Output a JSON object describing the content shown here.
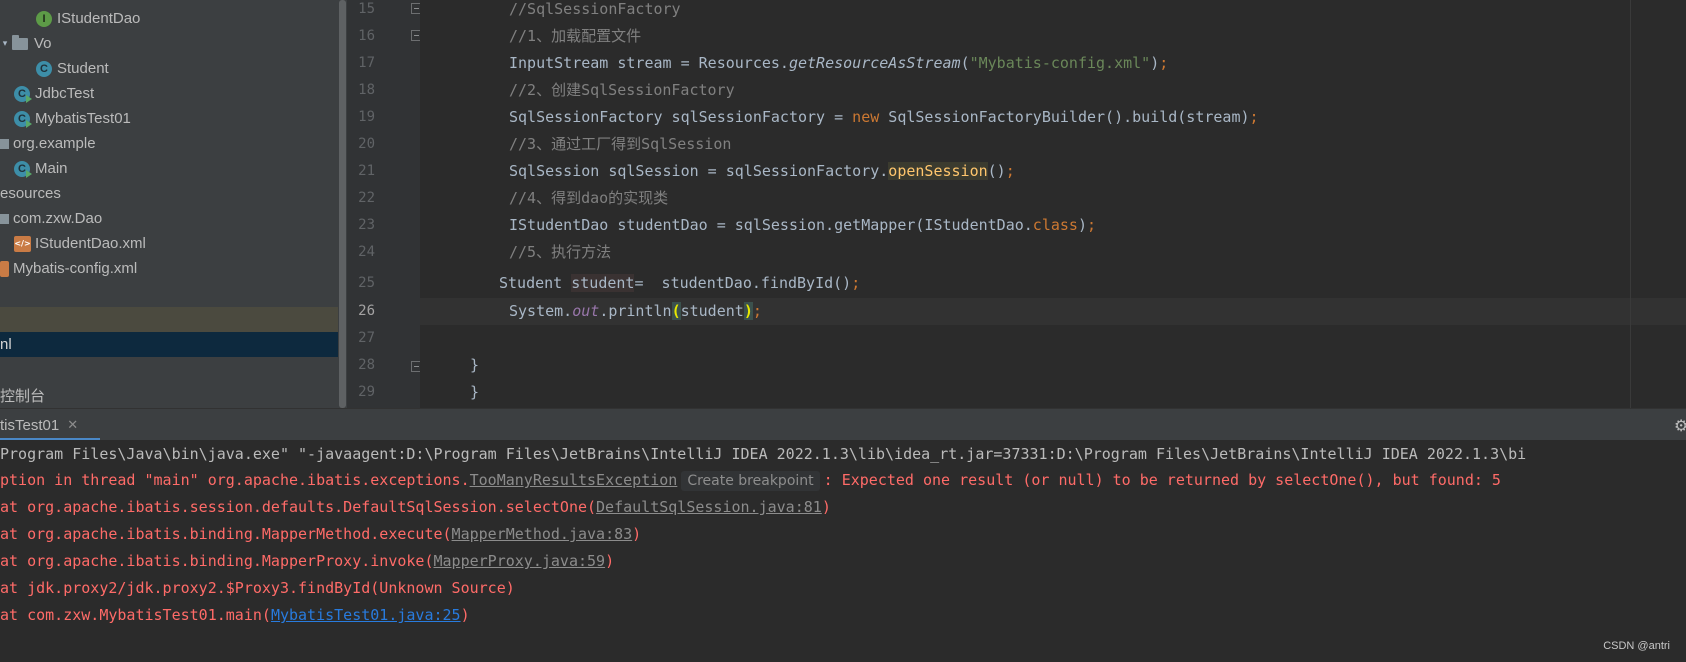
{
  "project_tree": {
    "items": [
      {
        "label": "IStudentDao",
        "icon": "interface-icon"
      },
      {
        "label": "Vo",
        "icon": "folder-icon"
      },
      {
        "label": "Student",
        "icon": "class-icon"
      },
      {
        "label": "JdbcTest",
        "icon": "class-icon"
      },
      {
        "label": "MybatisTest01",
        "icon": "class-icon"
      },
      {
        "label": "org.example",
        "icon": "package-icon"
      },
      {
        "label": "Main",
        "icon": "class-icon"
      },
      {
        "label": "esources",
        "icon": "none"
      },
      {
        "label": "com.zxw.Dao",
        "icon": "package-icon"
      },
      {
        "label": "IStudentDao.xml",
        "icon": "xml-icon"
      },
      {
        "label": "Mybatis-config.xml",
        "icon": "xml-icon"
      },
      {
        "label": "nl",
        "icon": "none"
      },
      {
        "label": "控制台",
        "icon": "none"
      }
    ]
  },
  "editor": {
    "current_line": "26",
    "line_numbers": [
      "15",
      "16",
      "17",
      "18",
      "19",
      "20",
      "21",
      "22",
      "23",
      "24",
      "25",
      "26",
      "27",
      "28",
      "29"
    ],
    "tokens": {
      "l15_comment": "//SqlSessionFactory",
      "l16_comment": "//1、加载配置文件",
      "l17_a": "InputStream stream = Resources.",
      "l17_method": "getResourceAsStream",
      "l17_open": "(",
      "l17_string": "\"Mybatis-config.xml\"",
      "l17_close": ")",
      "l17_semi": ";",
      "l18_comment": "//2、创建SqlSessionFactory",
      "l19_a": "SqlSessionFactory sqlSessionFactory = ",
      "l19_new": "new",
      "l19_b": " SqlSessionFactoryBuilder().build(stream)",
      "l19_semi": ";",
      "l20_comment": "//3、通过工厂得到SqlSession",
      "l21_a": "SqlSession sqlSession = sqlSessionFactory.",
      "l21_method": "openSession",
      "l21_b": "()",
      "l21_semi": ";",
      "l22_comment": "//4、得到dao的实现类",
      "l23_a": "IStudentDao studentDao = sqlSession.getMapper(IStudentDao.",
      "l23_class": "class",
      "l23_b": ")",
      "l23_semi": ";",
      "l24_comment": "//5、执行方法",
      "l25_a": "Student ",
      "l25_var": "student",
      "l25_b": "=  studentDao.findById()",
      "l25_semi": ";",
      "l26_a": "System.",
      "l26_out": "out",
      "l26_b": ".println",
      "l26_open": "(",
      "l26_arg": "student",
      "l26_close": ")",
      "l26_semi": ";",
      "l28_brace": "}",
      "l29_brace": "}"
    }
  },
  "run_panel": {
    "tab_label": "tisTest01",
    "close_glyph": "✕",
    "settings_icon": "gear-icon",
    "console": {
      "cmd": "Program Files\\Java\\bin\\java.exe\" \"-javaagent:D:\\Program Files\\JetBrains\\IntelliJ IDEA 2022.1.3\\lib\\idea_rt.jar=37331:D:\\Program Files\\JetBrains\\IntelliJ IDEA 2022.1.3\\bi",
      "exc_prefix": "ption in thread \"main\" org.apache.ibatis.exceptions.",
      "exc_class": "TooManyResultsException",
      "exc_hint": "Create breakpoint",
      "exc_message": ": Expected one result (or null) to be returned by selectOne(), but found: 5",
      "trace1_a": "at org.apache.ibatis.session.defaults.DefaultSqlSession.selectOne(",
      "trace1_link": "DefaultSqlSession.java:81",
      "trace1_b": ")",
      "trace2_a": "at org.apache.ibatis.binding.MapperMethod.execute(",
      "trace2_link": "MapperMethod.java:83",
      "trace2_b": ")",
      "trace3_a": "at org.apache.ibatis.binding.MapperProxy.invoke(",
      "trace3_link": "MapperProxy.java:59",
      "trace3_b": ")",
      "trace4": "at jdk.proxy2/jdk.proxy2.$Proxy3.findById(Unknown Source)",
      "trace5_a": "at com.zxw.MybatisTest01.main(",
      "trace5_link": "MybatisTest01.java:25",
      "trace5_b": ")"
    }
  },
  "watermark": "CSDN @antri",
  "colors": {
    "background": "#2b2b2b",
    "tree_background": "#3c3f41",
    "keyword": "#cc7832",
    "string": "#6a8759",
    "comment": "#808080",
    "error": "#ff6b68",
    "link": "#287bde"
  }
}
